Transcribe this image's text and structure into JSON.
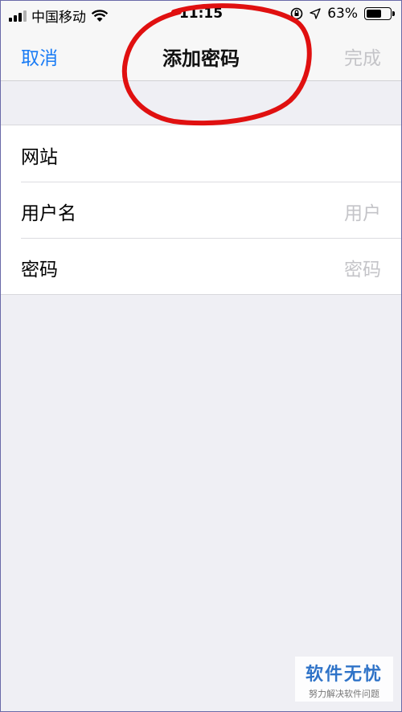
{
  "status_bar": {
    "carrier": "中国移动",
    "time": "11:15",
    "battery_percent": "63%",
    "battery_level": 0.63,
    "icons": [
      "signal-icon",
      "wifi-icon",
      "rotation-lock-icon",
      "location-arrow-icon",
      "battery-icon"
    ]
  },
  "nav": {
    "cancel_label": "取消",
    "title": "添加密码",
    "done_label": "完成"
  },
  "form": {
    "rows": [
      {
        "label": "网站",
        "placeholder": ""
      },
      {
        "label": "用户名",
        "placeholder": "用户"
      },
      {
        "label": "密码",
        "placeholder": "密码"
      }
    ]
  },
  "watermark": {
    "title": "软件无忧",
    "subtitle": "努力解决软件问题"
  },
  "colors": {
    "accent": "#1a7cf5",
    "annotation": "#e01010",
    "background": "#efeff4",
    "placeholder": "#c4c4c8"
  }
}
